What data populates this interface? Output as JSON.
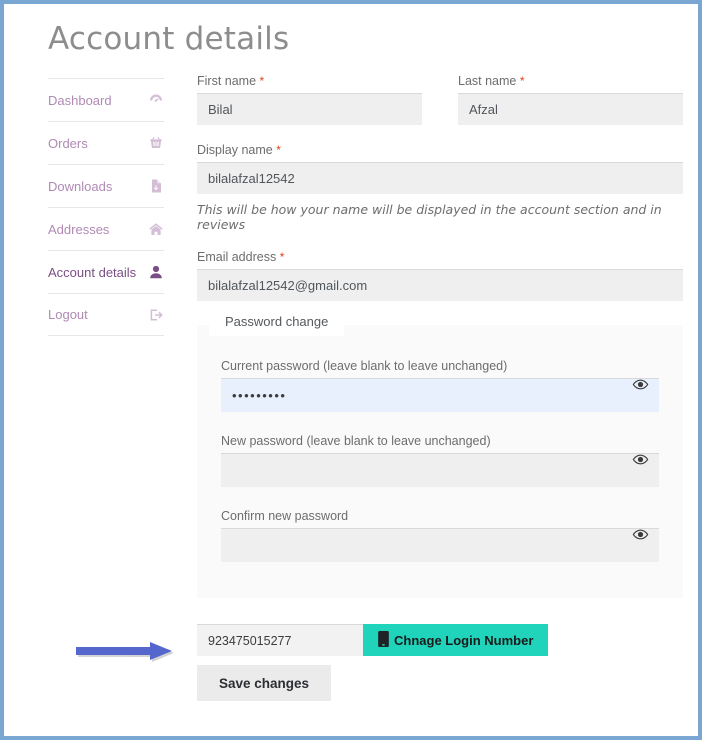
{
  "page": {
    "title": "Account details",
    "frame_border_color": "#7aa6d2"
  },
  "sidebar": {
    "items": [
      {
        "label": "Dashboard",
        "icon": "dashboard-gauge-icon",
        "active": false
      },
      {
        "label": "Orders",
        "icon": "shopping-basket-icon",
        "active": false
      },
      {
        "label": "Downloads",
        "icon": "file-download-icon",
        "active": false
      },
      {
        "label": "Addresses",
        "icon": "home-icon",
        "active": false
      },
      {
        "label": "Account details",
        "icon": "user-icon",
        "active": true
      },
      {
        "label": "Logout",
        "icon": "logout-icon",
        "active": false
      }
    ]
  },
  "form": {
    "first_name": {
      "label": "First name",
      "required_marker": "*",
      "value": "Bilal",
      "placeholder": ""
    },
    "last_name": {
      "label": "Last name",
      "required_marker": "*",
      "value": "Afzal",
      "placeholder": ""
    },
    "display_name": {
      "label": "Display name",
      "required_marker": "*",
      "value": "bilalafzal12542",
      "placeholder": ""
    },
    "display_name_help": "This will be how your name will be displayed in the account section and in reviews",
    "email": {
      "label": "Email address",
      "required_marker": "*",
      "value": "bilalafzal12542@gmail.com",
      "placeholder": ""
    }
  },
  "password_change": {
    "legend": "Password change",
    "current": {
      "label": "Current password (leave blank to leave unchanged)",
      "value": "•••••••••",
      "placeholder": "",
      "autofilled": true,
      "toggle_icon": "eye-icon"
    },
    "new": {
      "label": "New password (leave blank to leave unchanged)",
      "value": "",
      "placeholder": "",
      "autofilled": false,
      "toggle_icon": "eye-icon"
    },
    "confirm": {
      "label": "Confirm new password",
      "value": "",
      "placeholder": "",
      "autofilled": false,
      "toggle_icon": "eye-icon"
    }
  },
  "bottom": {
    "phone": {
      "value": "923475015277",
      "placeholder": ""
    },
    "change_number_button": {
      "label": "Chnage Login Number",
      "icon": "mobile-phone-icon",
      "color": "#1fd4bb"
    },
    "save_button": {
      "label": "Save changes"
    }
  },
  "annotation": {
    "arrow": {
      "color": "#5566cc",
      "direction": "right",
      "points_at": "phone-number-input"
    }
  }
}
